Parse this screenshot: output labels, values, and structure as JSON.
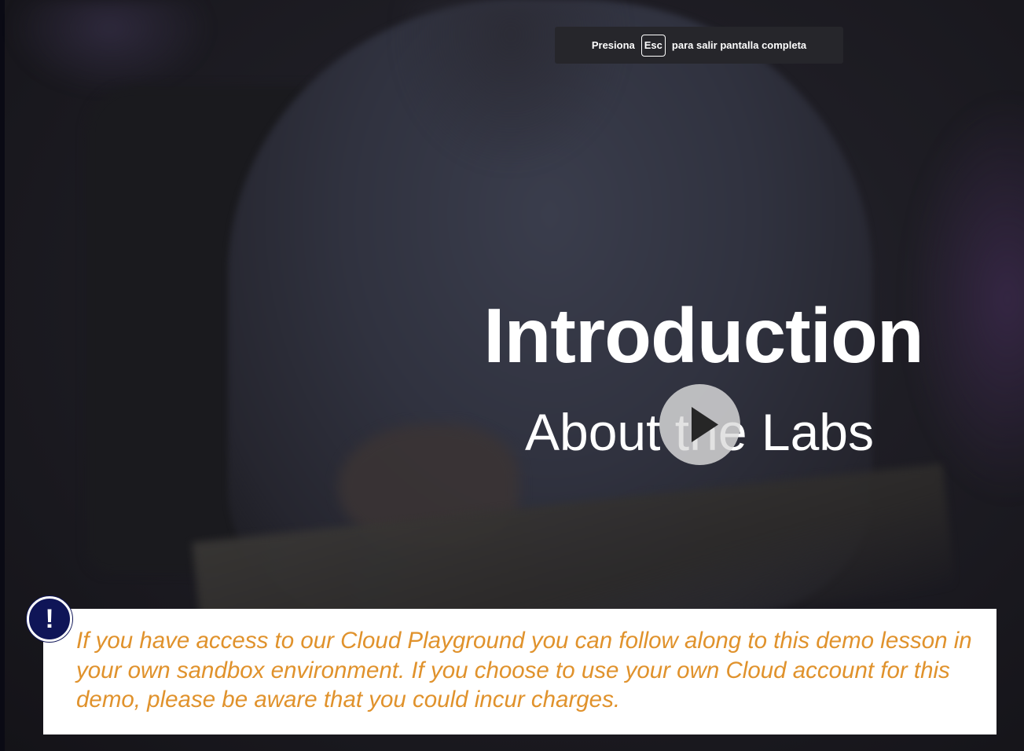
{
  "fullscreen_hint": {
    "prefix": "Presiona",
    "key": "Esc",
    "suffix": "para salir pantalla completa"
  },
  "slide": {
    "title": "Introduction",
    "subtitle": "About the Labs"
  },
  "player": {
    "play_icon": "play-icon"
  },
  "notice": {
    "icon_glyph": "!",
    "icon": "exclamation-icon",
    "text": "If you have access to our Cloud Playground you can follow along to this demo lesson in your own sandbox environment. If you choose to use your own Cloud account for this demo, please be aware that you could incur charges.",
    "text_color": "#e0922c",
    "badge_color": "#0f1557"
  }
}
